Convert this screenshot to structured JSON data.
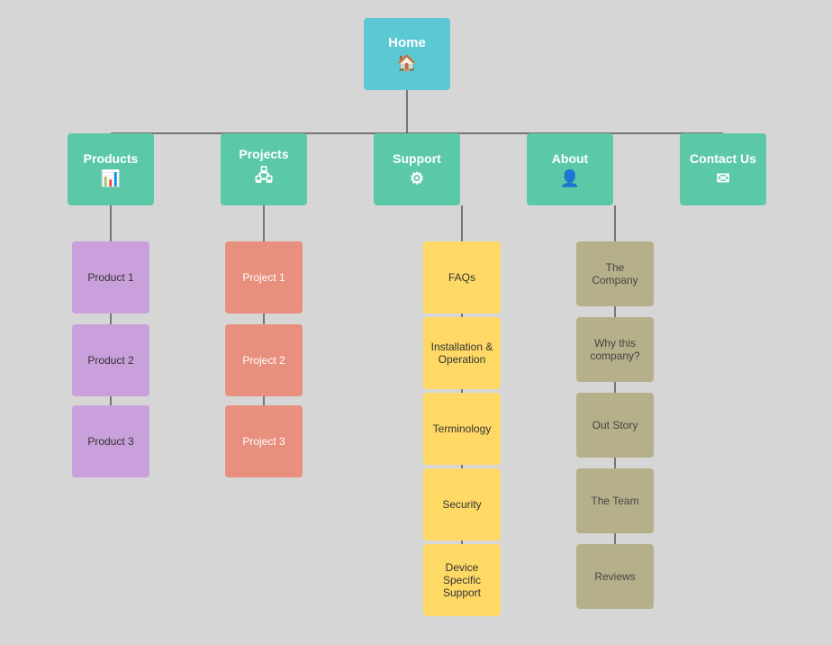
{
  "nodes": {
    "home": {
      "label": "Home",
      "icon": "🏠"
    },
    "products": {
      "label": "Products",
      "icon": "📊"
    },
    "projects": {
      "label": "Projects",
      "icon": "🖧"
    },
    "support": {
      "label": "Support",
      "icon": "⚙"
    },
    "about": {
      "label": "About",
      "icon": "👤"
    },
    "contact": {
      "label": "Contact Us",
      "icon": "✉"
    },
    "product1": {
      "label": "Product 1"
    },
    "product2": {
      "label": "Product 2"
    },
    "product3": {
      "label": "Product 3"
    },
    "project1": {
      "label": "Project 1"
    },
    "project2": {
      "label": "Project 2"
    },
    "project3": {
      "label": "Project 3"
    },
    "faqs": {
      "label": "FAQs"
    },
    "install": {
      "label": "Installation & Operation"
    },
    "terminology": {
      "label": "Terminology"
    },
    "security": {
      "label": "Security"
    },
    "device": {
      "label": "Device Specific Support"
    },
    "company": {
      "label": "The Company"
    },
    "why": {
      "label": "Why this company?"
    },
    "ourstory": {
      "label": "Out Story"
    },
    "team": {
      "label": "The Team"
    },
    "reviews": {
      "label": "Reviews"
    }
  }
}
